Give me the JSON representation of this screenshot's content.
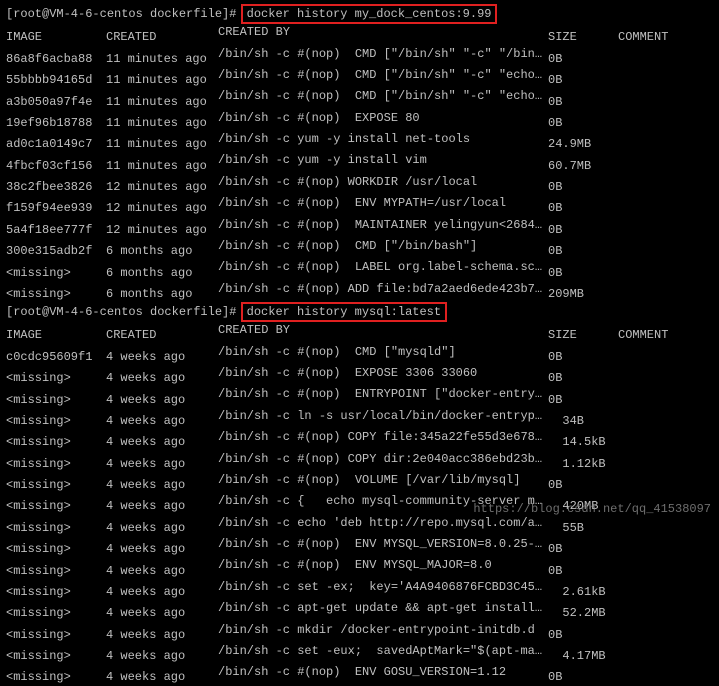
{
  "prompt1_prefix": "[root@VM-4-6-centos dockerfile]# ",
  "command1": "docker history my_dock_centos:9.99",
  "table1": {
    "headers": {
      "image": "IMAGE",
      "created": "CREATED",
      "by": "CREATED BY",
      "size": "SIZE",
      "comment": "COMMENT"
    },
    "rows": [
      {
        "image": "86a8f6acba88",
        "created": "11 minutes ago",
        "by": "/bin/sh -c #(nop)  CMD [\"/bin/sh\" \"-c\" \"/bin…",
        "size": "0B"
      },
      {
        "image": "55bbbb94165d",
        "created": "11 minutes ago",
        "by": "/bin/sh -c #(nop)  CMD [\"/bin/sh\" \"-c\" \"echo…",
        "size": "0B"
      },
      {
        "image": "a3b050a97f4e",
        "created": "11 minutes ago",
        "by": "/bin/sh -c #(nop)  CMD [\"/bin/sh\" \"-c\" \"echo…",
        "size": "0B"
      },
      {
        "image": "19ef96b18788",
        "created": "11 minutes ago",
        "by": "/bin/sh -c #(nop)  EXPOSE 80",
        "size": "0B"
      },
      {
        "image": "ad0c1a0149c7",
        "created": "11 minutes ago",
        "by": "/bin/sh -c yum -y install net-tools",
        "size": "24.9MB"
      },
      {
        "image": "4fbcf03cf156",
        "created": "11 minutes ago",
        "by": "/bin/sh -c yum -y install vim",
        "size": "60.7MB"
      },
      {
        "image": "38c2fbee3826",
        "created": "12 minutes ago",
        "by": "/bin/sh -c #(nop) WORKDIR /usr/local",
        "size": "0B"
      },
      {
        "image": "f159f94ee939",
        "created": "12 minutes ago",
        "by": "/bin/sh -c #(nop)  ENV MYPATH=/usr/local",
        "size": "0B"
      },
      {
        "image": "5a4f18ee777f",
        "created": "12 minutes ago",
        "by": "/bin/sh -c #(nop)  MAINTAINER yelingyun<2684…",
        "size": "0B"
      },
      {
        "image": "300e315adb2f",
        "created": "6 months ago",
        "by": "/bin/sh -c #(nop)  CMD [\"/bin/bash\"]",
        "size": "0B"
      },
      {
        "image": "<missing>",
        "created": "6 months ago",
        "by": "/bin/sh -c #(nop)  LABEL org.label-schema.sc…",
        "size": "0B"
      },
      {
        "image": "<missing>",
        "created": "6 months ago",
        "by": "/bin/sh -c #(nop) ADD file:bd7a2aed6ede423b7…",
        "size": "209MB"
      }
    ]
  },
  "prompt2_prefix": "[root@VM-4-6-centos dockerfile]# ",
  "command2": "docker history mysql:latest",
  "table2": {
    "headers": {
      "image": "IMAGE",
      "created": "CREATED",
      "by": "CREATED BY",
      "size": "SIZE",
      "comment": "COMMENT"
    },
    "rows": [
      {
        "image": "c0cdc95609f1",
        "created": "4 weeks ago",
        "by": "/bin/sh -c #(nop)  CMD [\"mysqld\"]",
        "size": "0B"
      },
      {
        "image": "<missing>",
        "created": "4 weeks ago",
        "by": "/bin/sh -c #(nop)  EXPOSE 3306 33060",
        "size": "0B"
      },
      {
        "image": "<missing>",
        "created": "4 weeks ago",
        "by": "/bin/sh -c #(nop)  ENTRYPOINT [\"docker-entry…",
        "size": "0B"
      },
      {
        "image": "<missing>",
        "created": "4 weeks ago",
        "by": "/bin/sh -c ln -s usr/local/bin/docker-entryp…",
        "size": "  34B"
      },
      {
        "image": "<missing>",
        "created": "4 weeks ago",
        "by": "/bin/sh -c #(nop) COPY file:345a22fe55d3e678…",
        "size": "  14.5kB"
      },
      {
        "image": "<missing>",
        "created": "4 weeks ago",
        "by": "/bin/sh -c #(nop) COPY dir:2e040acc386ebd23b…",
        "size": "  1.12kB"
      },
      {
        "image": "<missing>",
        "created": "4 weeks ago",
        "by": "/bin/sh -c #(nop)  VOLUME [/var/lib/mysql]",
        "size": "0B"
      },
      {
        "image": "<missing>",
        "created": "4 weeks ago",
        "by": "/bin/sh -c {   echo mysql-community-server m…",
        "size": "  420MB"
      },
      {
        "image": "<missing>",
        "created": "4 weeks ago",
        "by": "/bin/sh -c echo 'deb http://repo.mysql.com/a…",
        "size": "  55B"
      },
      {
        "image": "<missing>",
        "created": "4 weeks ago",
        "by": "/bin/sh -c #(nop)  ENV MYSQL_VERSION=8.0.25-…",
        "size": "0B"
      },
      {
        "image": "<missing>",
        "created": "4 weeks ago",
        "by": "/bin/sh -c #(nop)  ENV MYSQL_MAJOR=8.0",
        "size": "0B"
      },
      {
        "image": "<missing>",
        "created": "4 weeks ago",
        "by": "/bin/sh -c set -ex;  key='A4A9406876FCBD3C45…",
        "size": "  2.61kB"
      },
      {
        "image": "<missing>",
        "created": "4 weeks ago",
        "by": "/bin/sh -c apt-get update && apt-get install…",
        "size": "  52.2MB"
      },
      {
        "image": "<missing>",
        "created": "4 weeks ago",
        "by": "/bin/sh -c mkdir /docker-entrypoint-initdb.d",
        "size": "0B"
      },
      {
        "image": "<missing>",
        "created": "4 weeks ago",
        "by": "/bin/sh -c set -eux;  savedAptMark=\"$(apt-ma…",
        "size": "  4.17MB"
      },
      {
        "image": "<missing>",
        "created": "4 weeks ago",
        "by": "/bin/sh -c #(nop)  ENV GOSU_VERSION=1.12",
        "size": "0B"
      }
    ]
  },
  "watermark": "https://blog.csdn.net/qq_41538097"
}
